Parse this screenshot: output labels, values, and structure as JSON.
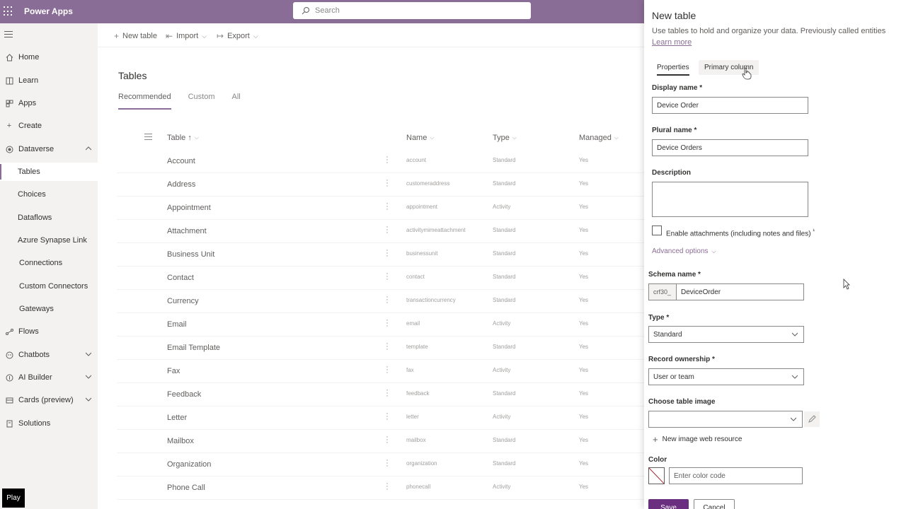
{
  "app": {
    "title": "Power Apps"
  },
  "search": {
    "placeholder": "Search"
  },
  "sidebar": {
    "items": [
      {
        "label": "Home",
        "icon": "home-icon"
      },
      {
        "label": "Learn",
        "icon": "book-icon"
      },
      {
        "label": "Apps",
        "icon": "apps-icon"
      },
      {
        "label": "Create",
        "icon": "plus-icon"
      },
      {
        "label": "Dataverse",
        "icon": "database-icon"
      },
      {
        "label": "Tables"
      },
      {
        "label": "Choices"
      },
      {
        "label": "Dataflows"
      },
      {
        "label": "Azure Synapse Link"
      },
      {
        "label": "Connections"
      },
      {
        "label": "Custom Connectors"
      },
      {
        "label": "Gateways"
      },
      {
        "label": "Flows",
        "icon": "flow-icon"
      },
      {
        "label": "Chatbots",
        "icon": "chatbot-icon"
      },
      {
        "label": "AI Builder",
        "icon": "ai-icon"
      },
      {
        "label": "Cards (preview)",
        "icon": "cards-icon"
      },
      {
        "label": "Solutions",
        "icon": "solutions-icon"
      }
    ]
  },
  "toolbar": {
    "new_table": "New table",
    "import": "Import",
    "export": "Export"
  },
  "main": {
    "title": "Tables",
    "tabs": [
      "Recommended",
      "Custom",
      "All"
    ],
    "columns": {
      "table": "Table",
      "table_sort": "↑",
      "name": "Name",
      "type": "Type",
      "managed": "Managed"
    },
    "rows": [
      {
        "table": "Account",
        "name": "account",
        "type": "Standard",
        "managed": "Yes"
      },
      {
        "table": "Address",
        "name": "customeraddress",
        "type": "Standard",
        "managed": "Yes"
      },
      {
        "table": "Appointment",
        "name": "appointment",
        "type": "Activity",
        "managed": "Yes"
      },
      {
        "table": "Attachment",
        "name": "activitymimeattachment",
        "type": "Standard",
        "managed": "Yes"
      },
      {
        "table": "Business Unit",
        "name": "businessunit",
        "type": "Standard",
        "managed": "Yes"
      },
      {
        "table": "Contact",
        "name": "contact",
        "type": "Standard",
        "managed": "Yes"
      },
      {
        "table": "Currency",
        "name": "transactioncurrency",
        "type": "Standard",
        "managed": "Yes"
      },
      {
        "table": "Email",
        "name": "email",
        "type": "Activity",
        "managed": "Yes"
      },
      {
        "table": "Email Template",
        "name": "template",
        "type": "Standard",
        "managed": "Yes"
      },
      {
        "table": "Fax",
        "name": "fax",
        "type": "Activity",
        "managed": "Yes"
      },
      {
        "table": "Feedback",
        "name": "feedback",
        "type": "Standard",
        "managed": "Yes"
      },
      {
        "table": "Letter",
        "name": "letter",
        "type": "Activity",
        "managed": "Yes"
      },
      {
        "table": "Mailbox",
        "name": "mailbox",
        "type": "Standard",
        "managed": "Yes"
      },
      {
        "table": "Organization",
        "name": "organization",
        "type": "Standard",
        "managed": "Yes"
      },
      {
        "table": "Phone Call",
        "name": "phonecall",
        "type": "Activity",
        "managed": "Yes"
      }
    ]
  },
  "panel": {
    "title": "New table",
    "description": "Use tables to hold and organize your data. Previously called entities",
    "learn_more": "Learn more",
    "tabs": {
      "properties": "Properties",
      "primary_column": "Primary column"
    },
    "display_name_label": "Display name *",
    "display_name_value": "Device Order",
    "plural_name_label": "Plural name *",
    "plural_name_value": "Device Orders",
    "description_label": "Description",
    "enable_attachments": "Enable attachments (including notes and files)",
    "enable_attachments_sup": "¹",
    "advanced_options": "Advanced options",
    "schema_label": "Schema name *",
    "schema_prefix": "crf30_",
    "schema_value": "DeviceOrder",
    "type_label": "Type *",
    "type_value": "Standard",
    "ownership_label": "Record ownership *",
    "ownership_value": "User or team",
    "image_label": "Choose table image",
    "new_image": "New image web resource",
    "color_label": "Color",
    "color_placeholder": "Enter color code",
    "save": "Save",
    "cancel": "Cancel"
  },
  "overlay": {
    "play": "Play"
  },
  "colors": {
    "header": "#8a6d96",
    "accent": "#6b2f7f",
    "sidebar": "#f3f2f1"
  }
}
